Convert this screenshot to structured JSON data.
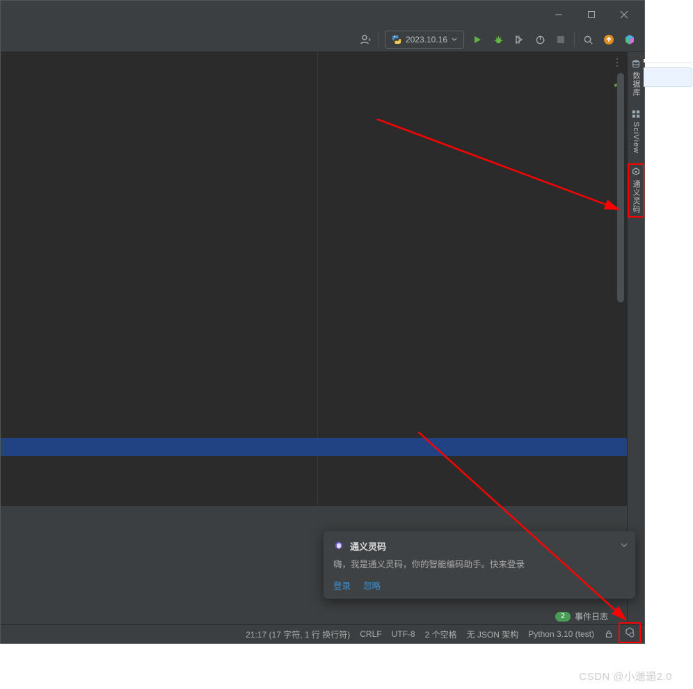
{
  "toolbar": {
    "run_config_label": "2023.10.16"
  },
  "right_strip": {
    "database_label": "数据库",
    "sciview_label": "SciView",
    "tongyi_label": "通义灵码"
  },
  "popup": {
    "title": "通义灵码",
    "body": "嗨，我是通义灵码，你的智能编码助手。快来登录",
    "login": "登录",
    "ignore": "忽略"
  },
  "event_log": {
    "count": "2",
    "label": "事件日志"
  },
  "status": {
    "caret": "21:17 (17 字符, 1 行 换行符)",
    "eol": "CRLF",
    "encoding": "UTF-8",
    "indent": "2 个空格",
    "schema": "无 JSON 架构",
    "interpreter": "Python 3.10 (test)"
  },
  "watermark": "CSDN @小邋遢2.0"
}
